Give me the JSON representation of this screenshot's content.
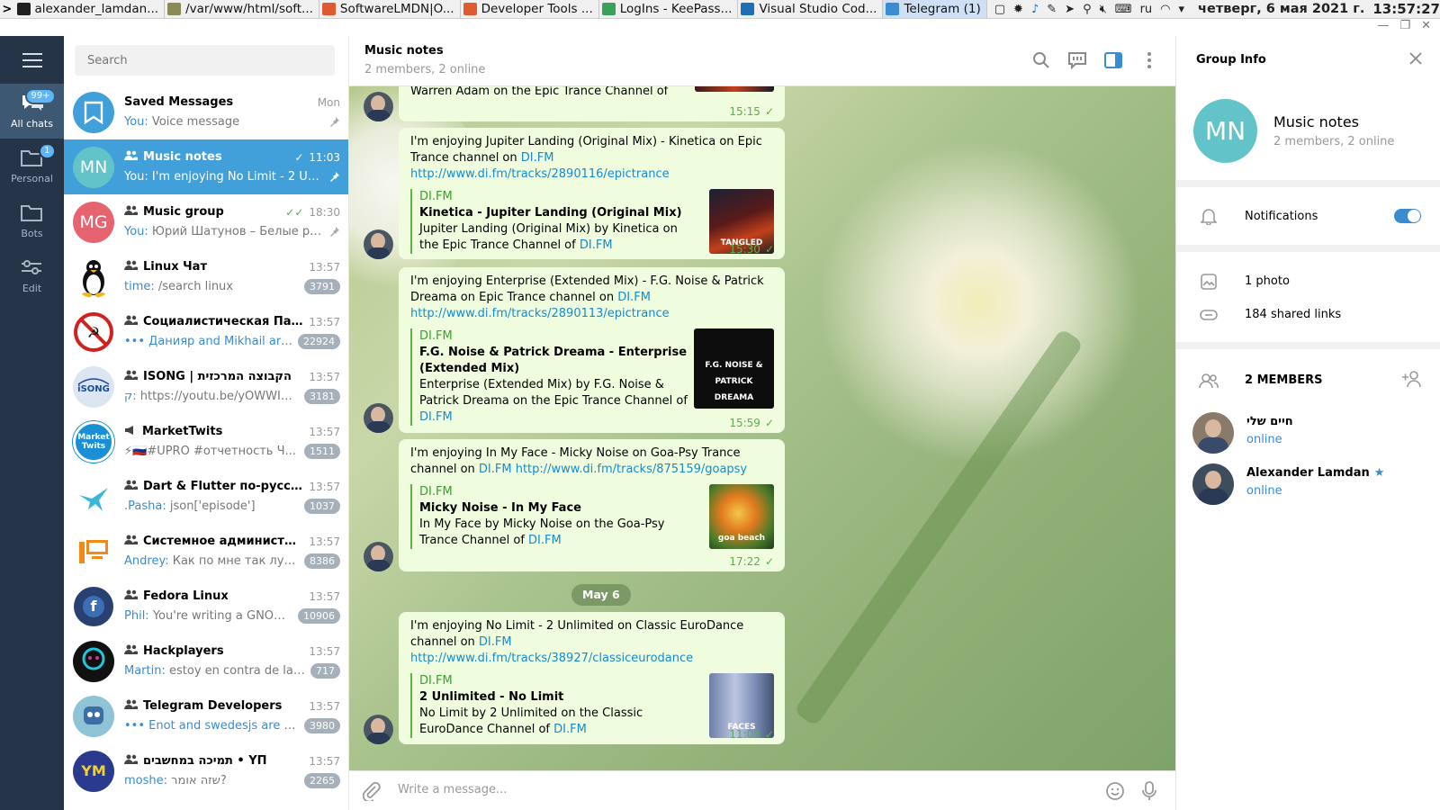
{
  "taskbar": {
    "tasks": [
      {
        "label": "alexander_lamdan...",
        "color": "#202020"
      },
      {
        "label": "/var/www/html/soft...",
        "color": "#8a8a55"
      },
      {
        "label": "SoftwareLMDN|O...",
        "color": "#e05a30"
      },
      {
        "label": "Developer Tools ...",
        "color": "#e05a30"
      },
      {
        "label": "LogIns - KeePass...",
        "color": "#3aa05a"
      },
      {
        "label": "Visual Studio Cod...",
        "color": "#1f6fb5"
      },
      {
        "label": "Telegram (1)",
        "color": "#3a8bd0"
      }
    ],
    "lang": "ru",
    "date": "четверг, 6 мая 2021 г.",
    "clock": "13:57:27"
  },
  "folders": [
    {
      "label": "All chats",
      "badge": "99+"
    },
    {
      "label": "Personal",
      "badge": "1"
    },
    {
      "label": "Bots",
      "badge": ""
    },
    {
      "label": "Edit",
      "badge": ""
    }
  ],
  "search": {
    "placeholder": "Search"
  },
  "chats": [
    {
      "name": "Saved Messages",
      "time": "Mon",
      "who": "You:",
      "preview": " Voice message",
      "badge": "",
      "avatar_text": "",
      "avatar_color": "#419fd9",
      "group": false
    },
    {
      "name": "Music notes",
      "time": "11:03",
      "who": "You:",
      "preview": " I'm enjoying No Limit - 2 Unl...",
      "badge": "",
      "avatar_text": "MN",
      "avatar_color": "#62c4c8",
      "group": true
    },
    {
      "name": "Music group",
      "time": "18:30",
      "who": "You:",
      "preview": " Юрий Шатунов – Белые ро...",
      "badge": "",
      "avatar_text": "MG",
      "avatar_color": "#e56470",
      "group": true
    },
    {
      "name": "Linux Чат",
      "time": "13:57",
      "who": "time:",
      "preview": " /search linux",
      "badge": "3791",
      "avatar_text": "",
      "avatar_color": "#ffffff",
      "group": true
    },
    {
      "name": "Социалистическая Парт...",
      "time": "13:57",
      "who": "••• Данияр and Mikhail are t...",
      "preview": "",
      "badge": "22924",
      "avatar_text": "",
      "avatar_color": "#ffffff",
      "group": true
    },
    {
      "name": "ISONG | הקבוצה המרכזית",
      "time": "13:57",
      "who": "ק:",
      "preview": " https://youtu.be/yOWWI2Ka...",
      "badge": "3181",
      "avatar_text": "",
      "avatar_color": "#dbe6f2",
      "group": true
    },
    {
      "name": "MarketTwits",
      "time": "13:57",
      "who": "",
      "preview": "⚡🇷🇺#UPRO #отчетность  Ч...",
      "badge": "1511",
      "avatar_text": "Market Twits",
      "avatar_color": "#1a8fd6",
      "group": false
    },
    {
      "name": "Dart & Flutter по-русски",
      "time": "13:57",
      "who": ".Pasha:",
      "preview": " json['episode']",
      "badge": "1037",
      "avatar_text": "",
      "avatar_color": "#ffffff",
      "group": true
    },
    {
      "name": "Системное администрир...",
      "time": "13:57",
      "who": "Andrey:",
      "preview": " Как по мне так лучш...",
      "badge": "8386",
      "avatar_text": "",
      "avatar_color": "#ffffff",
      "group": true
    },
    {
      "name": "Fedora Linux",
      "time": "13:57",
      "who": "Phil:",
      "preview": " You're writing a GNOME ...",
      "badge": "10906",
      "avatar_text": "f",
      "avatar_color": "#294172",
      "group": true
    },
    {
      "name": "Hackplayers",
      "time": "13:57",
      "who": "Martin:",
      "preview": " estoy en contra de la ce...",
      "badge": "717",
      "avatar_text": "",
      "avatar_color": "#111111",
      "group": true
    },
    {
      "name": "Telegram Developers",
      "time": "13:57",
      "who": "••• Enot and swedesjs are typi...",
      "preview": "",
      "badge": "3980",
      "avatar_text": "",
      "avatar_color": "#8fc3d6",
      "group": true
    },
    {
      "name": "תמיכה במחשבים • ΥΠ",
      "time": "13:57",
      "who": "moshe:",
      "preview": " שזה אומר?",
      "badge": "2265",
      "avatar_text": "YM",
      "avatar_color": "#2a3b8f",
      "group": true
    }
  ],
  "chat_header": {
    "title": "Music notes",
    "subtitle": "2 members, 2 online"
  },
  "messages": [
    {
      "text_pre": "Warren Adam on the Epic Trance Channel of ",
      "link": "DI...",
      "time": "15:15"
    },
    {
      "text": "I'm enjoying Jupiter Landing (Original Mix) - Kinetica on Epic Trance channel on ",
      "link1": "DI.FM",
      "link2": "http://www.di.fm/tracks/2890116/epictrance",
      "site": "DI.FM",
      "ptitle": "Kinetica - Jupiter Landing (Original Mix)",
      "pdesc": "Jupiter Landing (Original Mix) by Kinetica on the Epic Trance Channel of ",
      "plink": "DI.FM",
      "time": "15:30",
      "thumb_text": "TANGLED"
    },
    {
      "text": "I'm enjoying Enterprise (Extended Mix) - F.G. Noise & Patrick Dreama on Epic Trance channel on ",
      "link1": "DI.FM",
      "link2": "http://www.di.fm/tracks/2890113/epictrance",
      "site": "DI.FM",
      "ptitle": "F.G. Noise & Patrick Dreama - Enterprise (Extended Mix)",
      "pdesc": "Enterprise (Extended Mix) by F.G. Noise & Patrick Dreama on the Epic Trance Channel of ",
      "plink": "DI.FM",
      "time": "15:59",
      "thumb_text": "F.G. NOISE & PATRICK DREAMA"
    },
    {
      "text": "I'm enjoying In My Face - Micky Noise on Goa-Psy Trance channel on ",
      "link1": "DI.FM",
      "link2": "http://www.di.fm/tracks/875159/goapsy",
      "site": "DI.FM",
      "ptitle": "Micky Noise - In My Face",
      "pdesc": "In My Face by Micky Noise on the Goa-Psy Trance Channel of ",
      "plink": "DI.FM",
      "time": "17:22",
      "thumb_text": "goa beach"
    },
    {
      "text": "I'm enjoying No Limit - 2 Unlimited on Classic EuroDance channel on ",
      "link1": "DI.FM",
      "link2": "http://www.di.fm/tracks/38927/classiceurodance",
      "site": "DI.FM",
      "ptitle": "2 Unlimited - No Limit",
      "pdesc": "No Limit by 2 Unlimited on the Classic EuroDance Channel of ",
      "plink": "DI.FM",
      "time": "11:03",
      "thumb_text": "FACES"
    }
  ],
  "date_separator": "May 6",
  "composer": {
    "placeholder": "Write a message..."
  },
  "info": {
    "title": "Group Info",
    "avatar_text": "MN",
    "avatar_color": "#62c4c8",
    "name": "Music notes",
    "status": "2 members, 2 online",
    "notifications": "Notifications",
    "notifications_on": true,
    "photos": "1 photo",
    "links": "184 shared links",
    "members_header": "2 MEMBERS",
    "members": [
      {
        "name": "חיים שלי",
        "status": "online",
        "star": false
      },
      {
        "name": "Alexander Lamdan",
        "status": "online",
        "star": true
      }
    ]
  },
  "colors": {
    "accent": "#419fd9",
    "sidebar": "#253447",
    "bubble": "#effdde",
    "link": "#168acd",
    "check": "#58b04d"
  }
}
